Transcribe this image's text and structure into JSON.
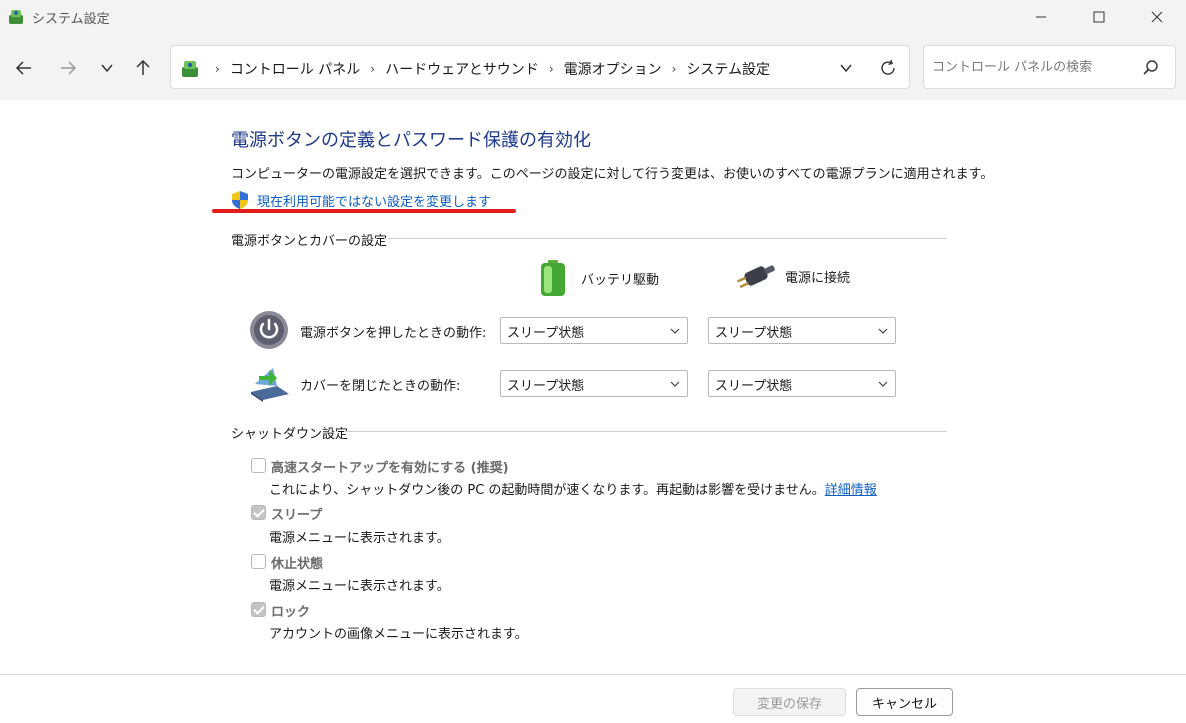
{
  "window": {
    "title": "システム設定"
  },
  "address": {
    "crumbs": [
      "コントロール パネル",
      "ハードウェアとサウンド",
      "電源オプション",
      "システム設定"
    ]
  },
  "search": {
    "placeholder": "コントロール パネルの検索"
  },
  "page": {
    "title": "電源ボタンの定義とパスワード保護の有効化",
    "intro": "コンピューターの電源設定を選択できます。このページの設定に対して行う変更は、お使いのすべての電源プランに適用されます。",
    "change_link": "現在利用可能ではない設定を変更します"
  },
  "power_section": {
    "heading": "電源ボタンとカバーの設定",
    "col_battery": "バッテリ駆動",
    "col_plugged": "電源に接続",
    "rows": [
      {
        "label": "電源ボタンを押したときの動作:",
        "battery": "スリープ状態",
        "plugged": "スリープ状態"
      },
      {
        "label": "カバーを閉じたときの動作:",
        "battery": "スリープ状態",
        "plugged": "スリープ状態"
      }
    ]
  },
  "shutdown_section": {
    "heading": "シャットダウン設定",
    "options": [
      {
        "title": "高速スタートアップを有効にする (推奨)",
        "desc": "これにより、シャットダウン後の PC の起動時間が速くなります。再起動は影響を受けません。",
        "link": "詳細情報",
        "checked": false
      },
      {
        "title": "スリープ",
        "desc": "電源メニューに表示されます。",
        "checked": true
      },
      {
        "title": "休止状態",
        "desc": "電源メニューに表示されます。",
        "checked": false
      },
      {
        "title": "ロック",
        "desc": "アカウントの画像メニューに表示されます。",
        "checked": true
      }
    ]
  },
  "footer": {
    "save": "変更の保存",
    "cancel": "キャンセル"
  },
  "colors": {
    "accent_link": "#0b5ec2",
    "title_blue": "#1e3a8a",
    "highlight_red": "#e11d1d"
  }
}
